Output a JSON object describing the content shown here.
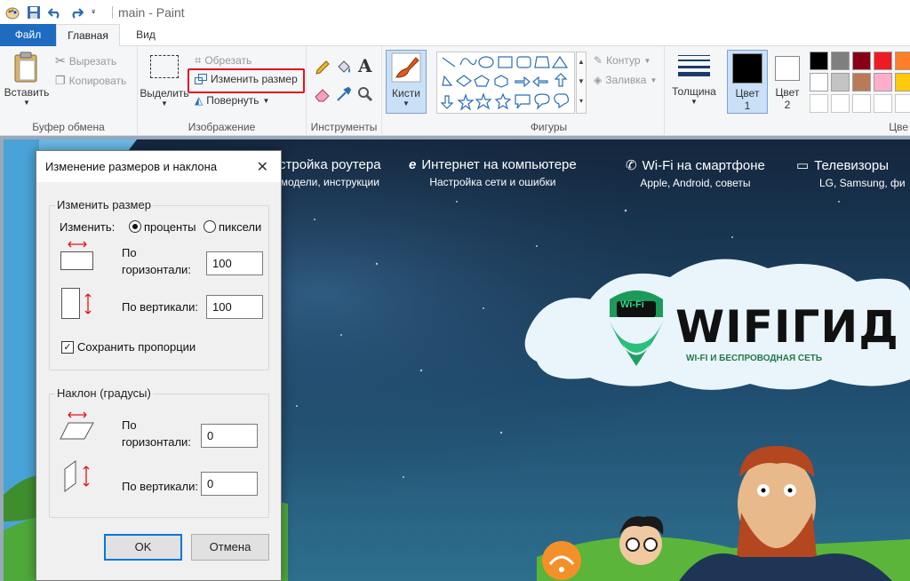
{
  "window": {
    "title": "main - Paint"
  },
  "tabs": {
    "file": "Файл",
    "home": "Главная",
    "view": "Вид"
  },
  "ribbon": {
    "clipboard": {
      "group_label": "Буфер обмена",
      "paste": "Вставить",
      "cut": "Вырезать",
      "copy": "Копировать"
    },
    "image": {
      "group_label": "Изображение",
      "select": "Выделить",
      "crop": "Обрезать",
      "resize": "Изменить размер",
      "rotate": "Повернуть"
    },
    "tools": {
      "group_label": "Инструменты"
    },
    "brushes": {
      "label": "Кисти"
    },
    "shapes": {
      "group_label": "Фигуры",
      "outline": "Контур",
      "fill": "Заливка"
    },
    "size": {
      "label": "Толщина"
    },
    "color1": {
      "label": "Цвет 1",
      "line1": "Цвет",
      "line2": "1"
    },
    "color2": {
      "label": "Цвет 2",
      "line1": "Цвет",
      "line2": "2"
    },
    "colors": {
      "group_label": "Цве",
      "palette": [
        "#000000",
        "#7f7f7f",
        "#880015",
        "#ed1c24",
        "#ff7f27",
        "#ffffff",
        "#c3c3c3",
        "#b97a57",
        "#ffaec9",
        "#ffc90e",
        "#ffffff",
        "#ffffff",
        "#ffffff",
        "#ffffff",
        "#ffffff"
      ]
    }
  },
  "canvas": {
    "nav": [
      {
        "title": "стройка роутера",
        "subtitle": "модели, инструкции"
      },
      {
        "title": "Интернет на компьютере",
        "subtitle": "Настройка сети и ошибки"
      },
      {
        "title": "Wi-Fi на смартфоне",
        "subtitle": "Apple, Android, советы"
      },
      {
        "title": "Телевизоры",
        "subtitle": "LG, Samsung, фи"
      }
    ],
    "logo": {
      "title": "WIFIГИД",
      "tagline": "WI-FI И БЕСПРОВОДНАЯ СЕТЬ",
      "badge": "Wi-Fi"
    }
  },
  "dialog": {
    "title": "Изменение размеров и наклона",
    "resize": {
      "legend": "Изменить размер",
      "by_label": "Изменить:",
      "option_percent": "проценты",
      "option_pixels": "пиксели",
      "horizontal_label_1": "По",
      "horizontal_label_2": "горизонтали:",
      "horizontal_value": "100",
      "vertical_label": "По вертикали:",
      "vertical_value": "100",
      "keep_ratio": "Сохранить пропорции"
    },
    "skew": {
      "legend": "Наклон (градусы)",
      "horizontal_label_1": "По",
      "horizontal_label_2": "горизонтали:",
      "horizontal_value": "0",
      "vertical_label": "По вертикали:",
      "vertical_value": "0"
    },
    "ok": "OK",
    "cancel": "Отмена"
  }
}
